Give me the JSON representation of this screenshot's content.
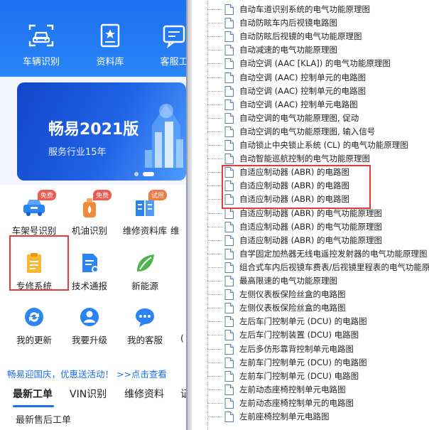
{
  "app": {
    "top_nav": [
      {
        "label": "车辆识别",
        "icon": "car-scan-icon"
      },
      {
        "label": "资料库",
        "icon": "book-star-icon"
      },
      {
        "label": "客服工",
        "icon": "chat-icon"
      }
    ],
    "banner": {
      "title": "畅易2021版",
      "subtitle": "服务行业15年"
    },
    "grid": [
      {
        "label": "车架号识别",
        "icon": "vin-car-icon",
        "badge": "免费"
      },
      {
        "label": "机油识别",
        "icon": "oil-drop-icon",
        "badge": "免费"
      },
      {
        "label": "维修资料库",
        "icon": "repair-book-icon",
        "badge": "试用"
      },
      {
        "label": "维",
        "icon": "more-icon",
        "badge": ""
      },
      {
        "label": "专修系统",
        "icon": "clipboard-icon",
        "badge": ""
      },
      {
        "label": "技术通报",
        "icon": "bulletin-icon",
        "badge": ""
      },
      {
        "label": "新能源",
        "icon": "leaf-icon",
        "badge": ""
      },
      {
        "label": "我的更新",
        "icon": "refresh-icon",
        "badge": ""
      },
      {
        "label": "我要升级",
        "icon": "upgrade-user-icon",
        "badge": ""
      },
      {
        "label": "我的客服",
        "icon": "chat-bubble-icon",
        "badge": ""
      },
      {
        "label": "(",
        "icon": "more-icon-2",
        "badge": ""
      }
    ],
    "promo": "畅易迎国庆，优惠送活动！ >>点击查看",
    "tabs": [
      "最新工单",
      "VIN识别",
      "维修资料",
      "证"
    ],
    "sub_title": "最新售后工单"
  },
  "tree": {
    "items": [
      "自动车道识别系统的电气功能原理图",
      "自动防眩车内后视镜电路图",
      "自动防眩后视镜的电气功能原理图",
      "自动减速的电气功能原理图",
      "自动空调 (AAC [KLA]) 的电气功能原理图",
      "自动空调 (AAC) 控制单元的电路图",
      "自动空调 (AAC) 控制单元的电路图",
      "自动空调 (AAC) 控制单元电路图",
      "自动空调的电气功能原理图, 促动",
      "自动空调的电气功能原理图, 输入信号",
      "自动锁止中央锁止系统 (CL) 的电气功能原理图",
      "自动智能巡航控制的电气功能原理图",
      "自适应制动器 (ABR) 的电路图",
      "自适应制动器 (ABR) 的电路图",
      "自适应制动器 (ABR) 的电路图",
      "自适应制动器 (ABR) 的电气功能原理图",
      "自适应制动器 (ABR) 的电气功能原理图",
      "自适应制动器 (ABR) 的电气功能原理图",
      "自学固定加热器无线电遥控发射器的电气功能原理图",
      "组合式车内后视镜车费表/后视镜里程表的电气功能原理图",
      "最高限速的电气功能原理图",
      "左侧仪表板保险丝盒的电路图",
      "左侧仪表板保险丝盒的电路图",
      "左后车门控制单元 (DCU) 的电路图",
      "左后车门控制装置 (DCU) 电路图",
      "左后多仿形靠背控制单元电路图",
      "左前车门控制单元 (DCU) 的电路图",
      "左前车门控制单元 (DCU) 电路图",
      "左前动态座椅控制单元电路图",
      "左前动态座椅控制单元的电路图",
      "左前座椅控制单元电路图"
    ]
  },
  "colors": {
    "primary": "#1a6ff2",
    "highlight": "#e23b3b",
    "badge": "#f05a4f"
  }
}
